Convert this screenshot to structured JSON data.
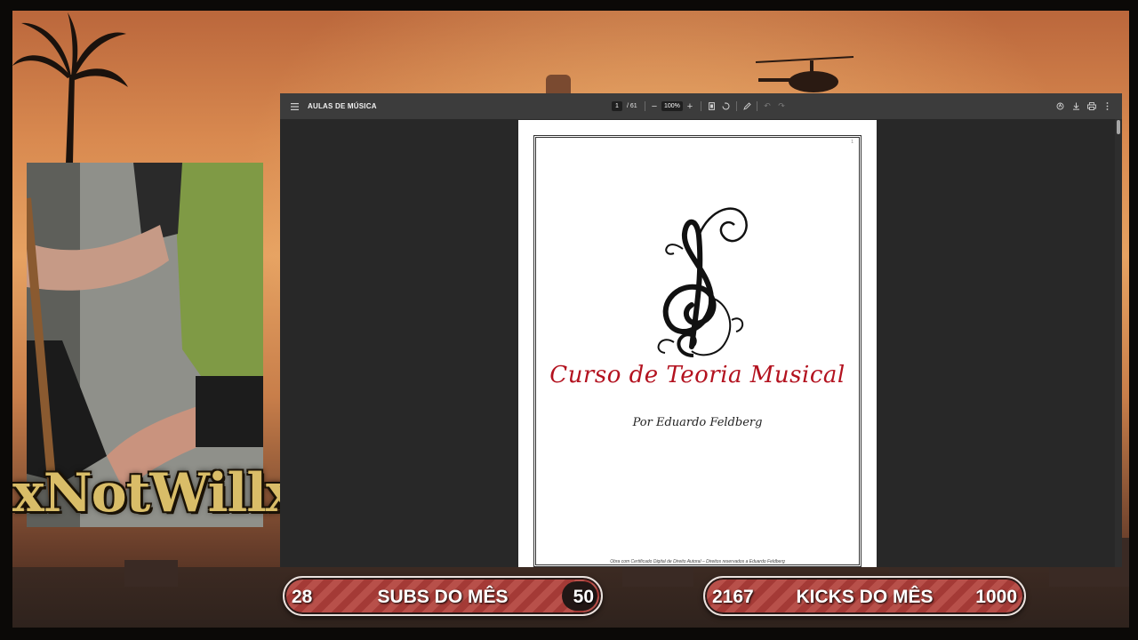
{
  "overlay": {
    "streamer_name": "xNotWillx",
    "goals": {
      "subs": {
        "current": "28",
        "label": "SUBS DO MÊS",
        "target": "50"
      },
      "kicks": {
        "current": "2167",
        "label": "KICKS DO MÊS",
        "target": "1000"
      }
    }
  },
  "pdf_viewer": {
    "title": "AULAS DE MÚSICA",
    "current_page": "1",
    "page_total": "/ 61",
    "zoom": "100%",
    "icons": {
      "menu": "menu-icon",
      "zoom_out": "zoom-out-icon",
      "zoom_in": "zoom-in-icon",
      "fit_page": "fit-page-icon",
      "rotate": "rotate-icon",
      "draw": "draw-icon",
      "undo": "undo-icon",
      "redo": "redo-icon",
      "annotate": "annotate-icon",
      "download": "download-icon",
      "print": "print-icon",
      "more": "more-options-icon"
    },
    "document": {
      "page_number_mark": "1",
      "title": "Curso de Teoria Musical",
      "author": "Por Eduardo Feldberg",
      "footer": "Obra com Certificado Digital de Direito Autoral – Direitos reservados a Eduardo Feldberg"
    }
  },
  "colors": {
    "toolbar": "#3c3c3c",
    "viewer_bg": "#282828",
    "title_red": "#b3121f",
    "goal_red": "#a43a36",
    "name_gold": "#d9bd68"
  }
}
